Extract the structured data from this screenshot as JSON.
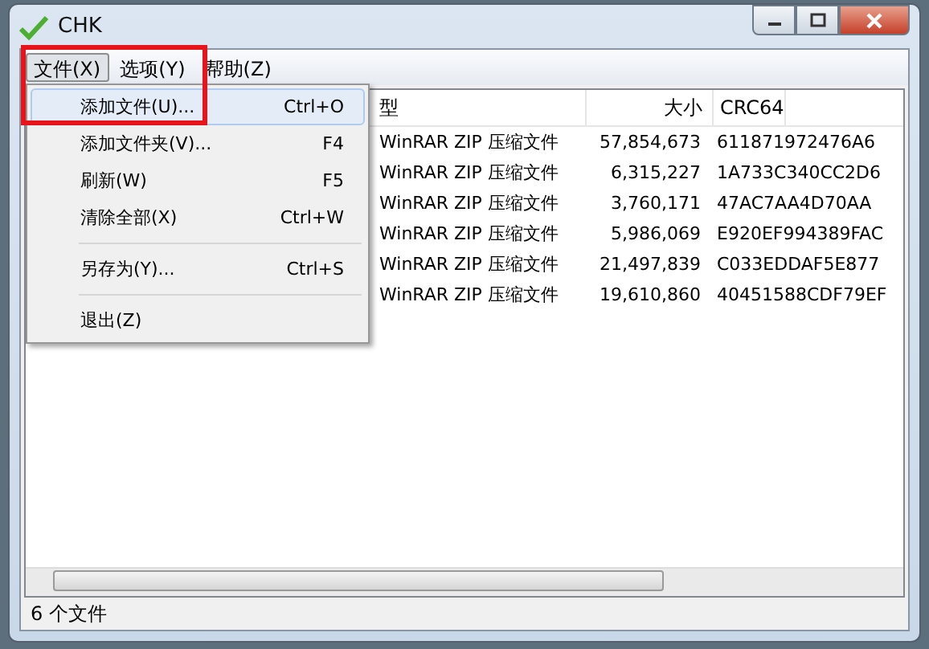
{
  "window": {
    "title": "CHK"
  },
  "menu_bar": [
    {
      "label": "文件(X)",
      "selected": true
    },
    {
      "label": "选项(Y)",
      "selected": false
    },
    {
      "label": "帮助(Z)",
      "selected": false
    }
  ],
  "file_menu": [
    {
      "kind": "item",
      "label": "添加文件(U)...",
      "shortcut": "Ctrl+O",
      "selected": true
    },
    {
      "kind": "item",
      "label": "添加文件夹(V)...",
      "shortcut": "F4",
      "selected": false
    },
    {
      "kind": "item",
      "label": "刷新(W)",
      "shortcut": "F5",
      "selected": false
    },
    {
      "kind": "item",
      "label": "清除全部(X)",
      "shortcut": "Ctrl+W",
      "selected": false
    },
    {
      "kind": "separator"
    },
    {
      "kind": "item",
      "label": "另存为(Y)...",
      "shortcut": "Ctrl+S",
      "selected": false
    },
    {
      "kind": "separator"
    },
    {
      "kind": "item",
      "label": "退出(Z)",
      "selected": false
    }
  ],
  "table": {
    "columns": [
      "型",
      "大小",
      "CRC64"
    ],
    "rows": [
      [
        "WinRAR ZIP 压缩文件",
        "57,854,673",
        "611871972476A6"
      ],
      [
        "WinRAR ZIP 压缩文件",
        "6,315,227",
        "1A733C340CC2D6"
      ],
      [
        "WinRAR ZIP 压缩文件",
        "3,760,171",
        "47AC7AA4D70AA"
      ],
      [
        "WinRAR ZIP 压缩文件",
        "5,986,069",
        "E920EF994389FAC"
      ],
      [
        "WinRAR ZIP 压缩文件",
        "21,497,839",
        "C033EDDAF5E877"
      ],
      [
        "WinRAR ZIP 压缩文件",
        "19,610,860",
        "40451588CDF79EF"
      ]
    ]
  },
  "status_bar": "6 个文件"
}
